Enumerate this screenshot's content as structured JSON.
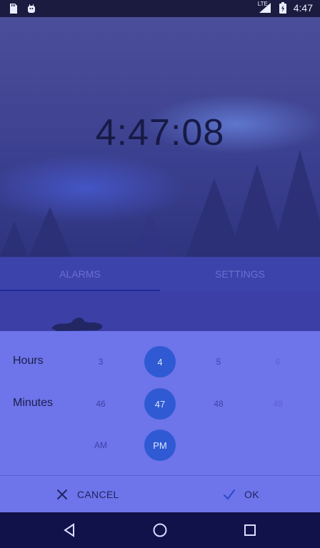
{
  "status_bar": {
    "time": "4:47",
    "network": "LTE"
  },
  "clock": {
    "time": "4:47:08"
  },
  "tabs": [
    {
      "label": "ALARMS",
      "selected": true
    },
    {
      "label": "SETTINGS",
      "selected": false
    }
  ],
  "picker": {
    "hours_label": "Hours",
    "minutes_label": "Minutes",
    "hours": [
      "3",
      "4",
      "5",
      "6"
    ],
    "minutes": [
      "46",
      "47",
      "48",
      "49"
    ],
    "ampm": [
      "AM",
      "PM"
    ],
    "selected": {
      "hour": "4",
      "minute": "47",
      "ampm": "PM"
    }
  },
  "actions": {
    "cancel": "CANCEL",
    "ok": "OK"
  },
  "colors": {
    "accent": "#2f5ad3",
    "sheet": "#6e74e9"
  }
}
